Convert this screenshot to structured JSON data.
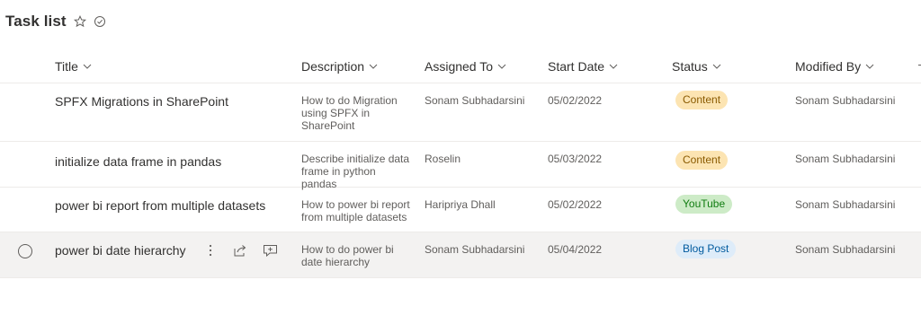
{
  "header": {
    "title": "Task list"
  },
  "columns": {
    "title": "Title",
    "description": "Description",
    "assigned_to": "Assigned To",
    "start_date": "Start Date",
    "status": "Status",
    "modified_by": "Modified By"
  },
  "rows": [
    {
      "title": "SPFX Migrations in SharePoint",
      "description": "How to do Migration using SPFX in SharePoint",
      "assigned_to": "Sonam Subhadarsini",
      "start_date": "05/02/2022",
      "status": "Content",
      "modified_by": "Sonam Subhadarsini"
    },
    {
      "title": "initialize data frame in pandas",
      "description": "Describe initialize data frame in python pandas",
      "assigned_to": "Roselin",
      "start_date": "05/03/2022",
      "status": "Content",
      "modified_by": "Sonam Subhadarsini"
    },
    {
      "title": "power bi report from multiple datasets",
      "description": "How to power bi report from multiple datasets",
      "assigned_to": "Haripriya Dhall",
      "start_date": "05/02/2022",
      "status": "YouTube",
      "modified_by": "Sonam Subhadarsini"
    },
    {
      "title": "power bi date hierarchy",
      "description": "How to do power bi date hierarchy",
      "assigned_to": "Sonam Subhadarsini",
      "start_date": "05/04/2022",
      "status": "Blog Post",
      "modified_by": "Sonam Subhadarsini"
    }
  ],
  "status_colors": {
    "Content": "#fce4b2",
    "YouTube": "#cdebc7",
    "Blog Post": "#deecf9"
  },
  "icons": [
    "star-icon",
    "checkmark-circle-icon",
    "chevron-down-icon",
    "more-vertical-icon",
    "share-icon",
    "comment-add-icon"
  ]
}
